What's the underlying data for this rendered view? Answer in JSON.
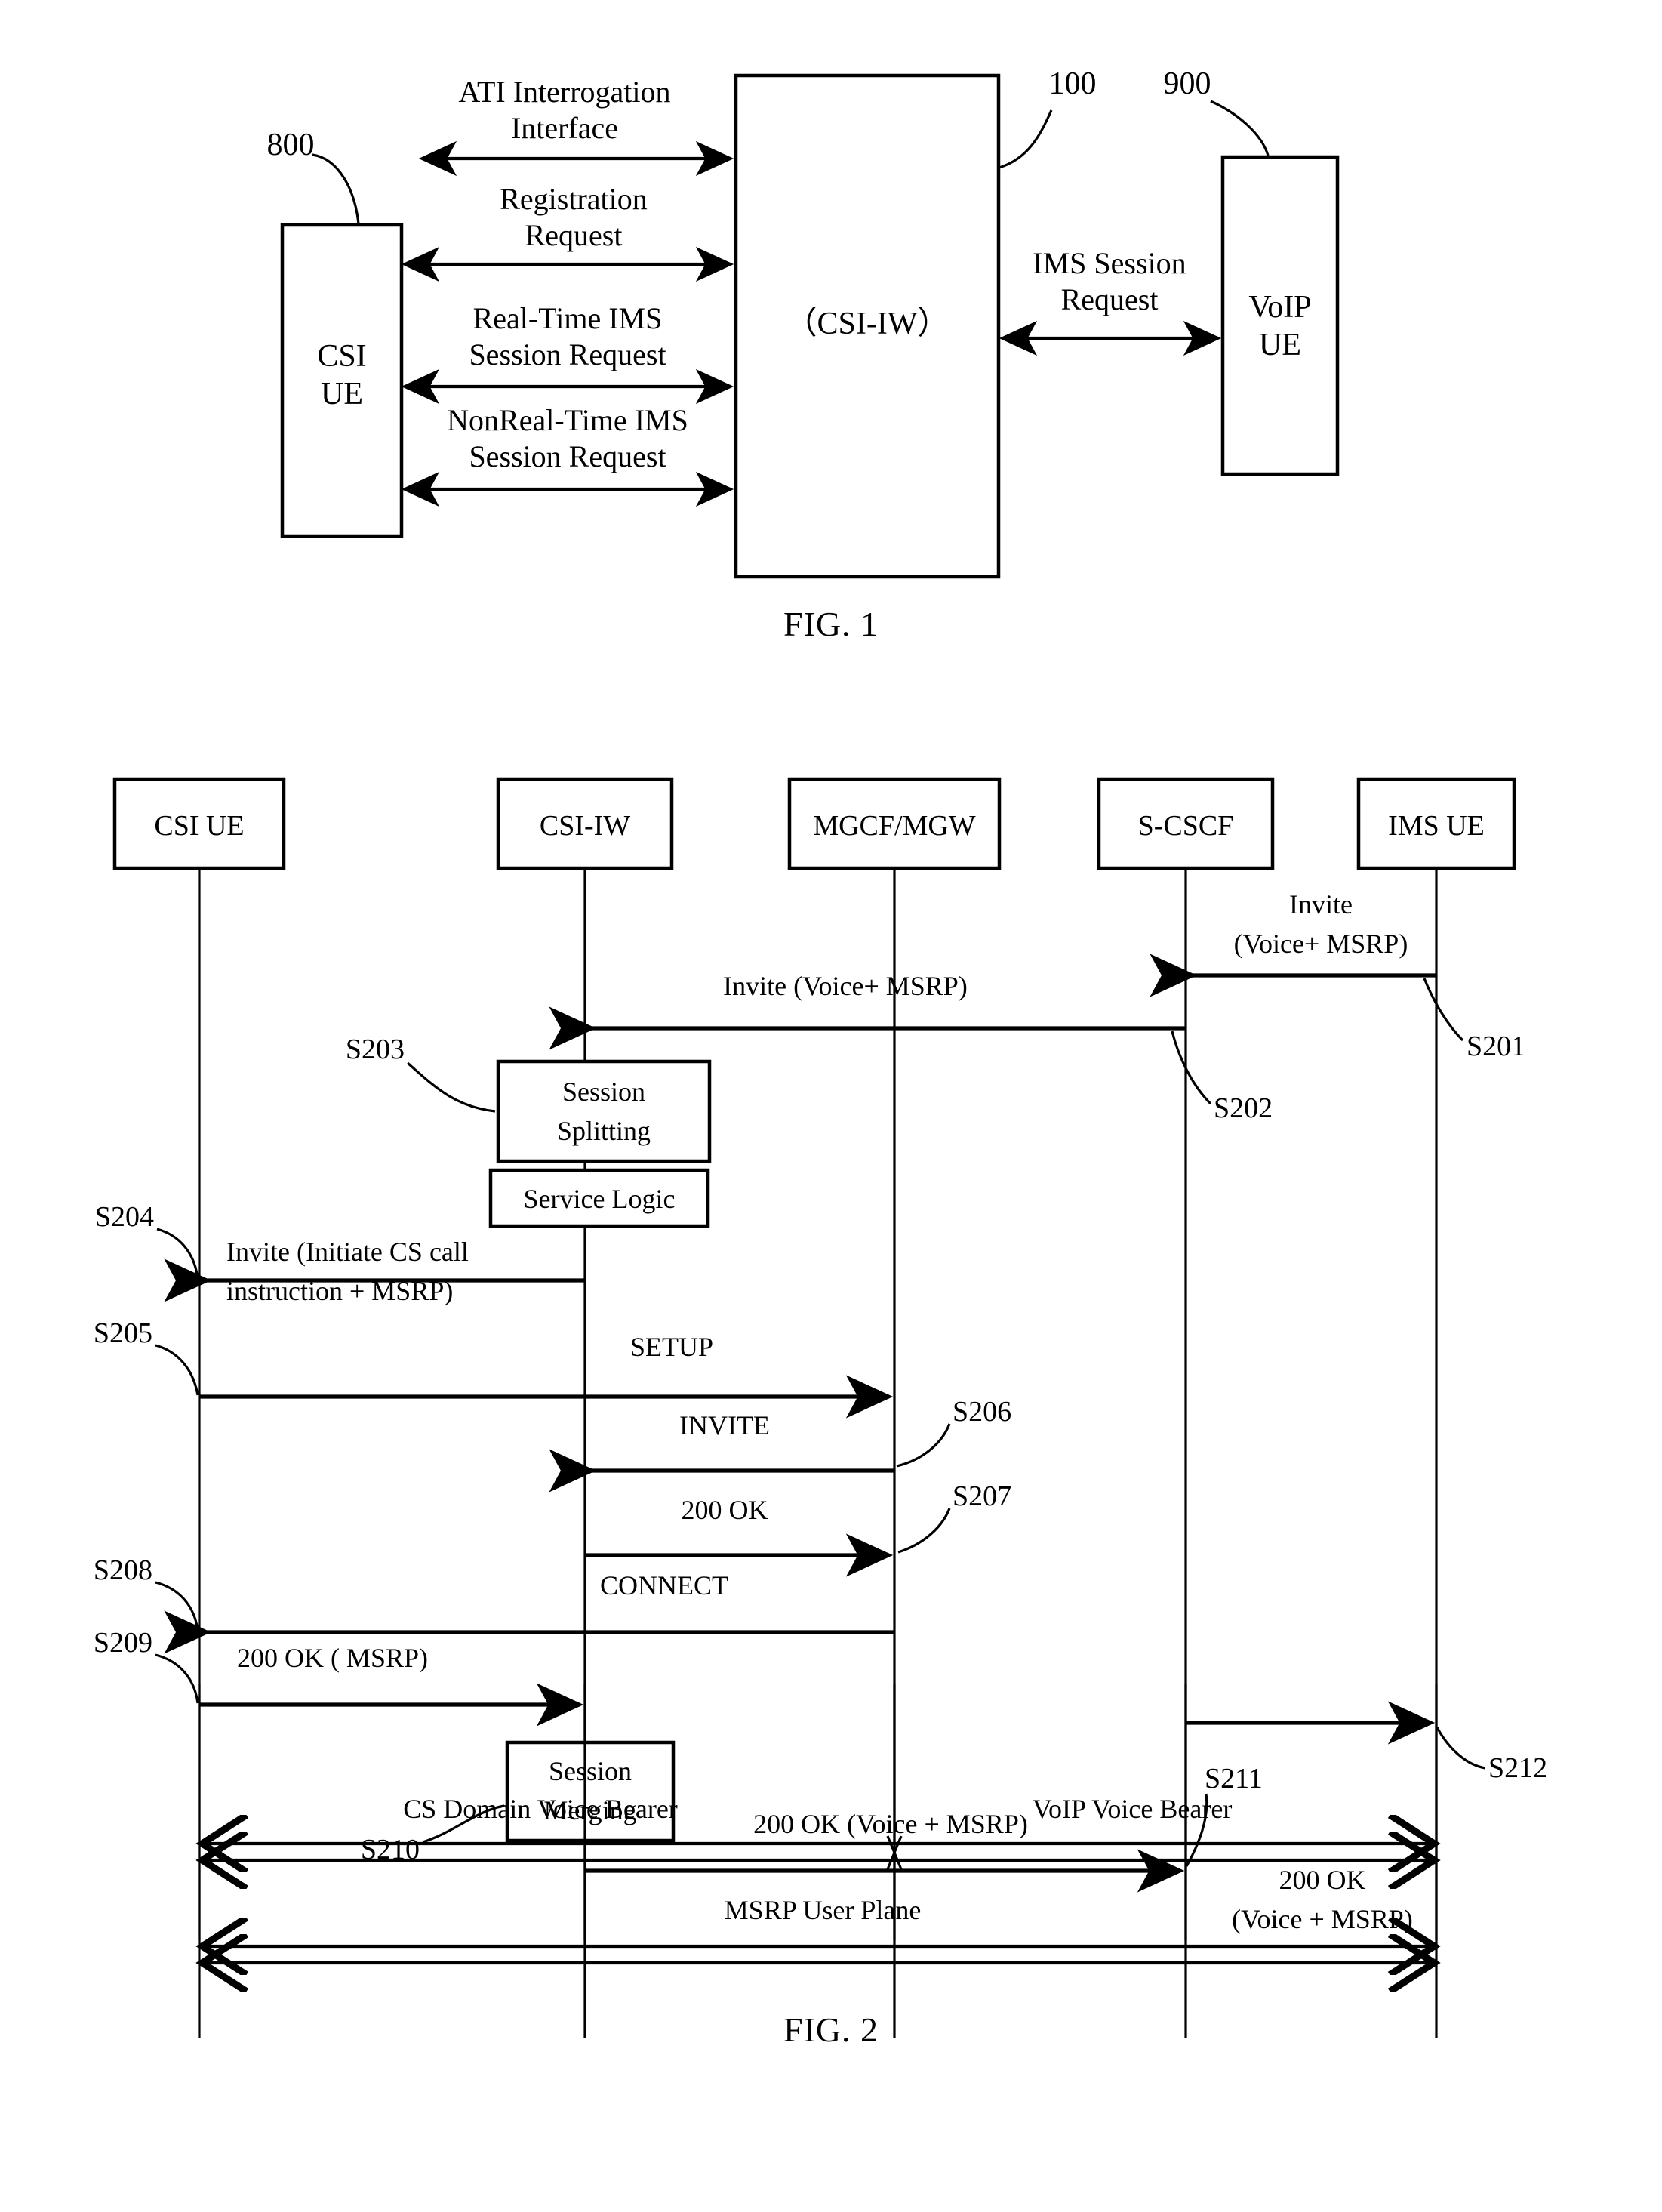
{
  "document": {
    "type": "patent-figure-sheet",
    "figures": [
      {
        "id": "fig1",
        "caption": "FIG. 1"
      },
      {
        "id": "fig2",
        "caption": "FIG. 2"
      }
    ]
  },
  "fig1": {
    "caption": "FIG. 1",
    "nodes": {
      "csi_ue": {
        "line1": "CSI",
        "line2": "UE",
        "ref": "800"
      },
      "csi_iw": {
        "label": "（CSI-IW）",
        "ref": "100"
      },
      "voip_ue": {
        "line1": "VoIP",
        "line2": "UE",
        "ref": "900"
      }
    },
    "interfaces": [
      {
        "line1": "ATI Interrogation",
        "line2": "Interface"
      },
      {
        "line1": "Registration",
        "line2": "Request"
      },
      {
        "line1": "Real-Time IMS",
        "line2": "Session Request"
      },
      {
        "line1": "NonReal-Time IMS",
        "line2": "Session Request"
      },
      {
        "line1": "IMS Session",
        "line2": "Request"
      }
    ]
  },
  "fig2": {
    "caption": "FIG. 2",
    "lifelines": [
      {
        "label": "CSI UE"
      },
      {
        "label": "CSI-IW"
      },
      {
        "label": "MGCF/MGW"
      },
      {
        "label": "S-CSCF"
      },
      {
        "label": "IMS UE"
      }
    ],
    "process_boxes": [
      {
        "line1": "Session",
        "line2": "Splitting",
        "step": "S203"
      },
      {
        "line1": "Service Logic",
        "line2": ""
      },
      {
        "line1": "Session",
        "line2": "Merging",
        "step": "S210"
      }
    ],
    "messages": [
      {
        "step": "S201",
        "line1": "Invite",
        "line2": "(Voice+ MSRP)",
        "from": "IMS UE",
        "to": "S-CSCF"
      },
      {
        "step": "S202",
        "line1": "Invite  (Voice+ MSRP)",
        "line2": "",
        "from": "S-CSCF",
        "to": "CSI-IW"
      },
      {
        "step": "S204",
        "line1": "Invite (Initiate CS call",
        "line2": "instruction + MSRP)",
        "from": "CSI-IW",
        "to": "CSI UE"
      },
      {
        "step": "S205",
        "line1": "SETUP",
        "line2": "",
        "from": "CSI UE",
        "to": "MGCF/MGW"
      },
      {
        "step": "S206",
        "line1": "INVITE",
        "line2": "",
        "from": "MGCF/MGW",
        "to": "CSI-IW"
      },
      {
        "step": "S207",
        "line1": "200 OK",
        "line2": "",
        "from": "CSI-IW",
        "to": "MGCF/MGW"
      },
      {
        "step": "S208",
        "line1": "CONNECT",
        "line2": "",
        "from": "MGCF/MGW",
        "to": "CSI UE"
      },
      {
        "step": "S209",
        "line1": "200 OK ( MSRP)",
        "line2": "",
        "from": "CSI UE",
        "to": "CSI-IW"
      },
      {
        "step": "S211",
        "line1": "200 OK (Voice + MSRP)",
        "line2": "",
        "from": "CSI-IW",
        "to": "S-CSCF"
      },
      {
        "step": "S212",
        "line1": "200 OK",
        "line2": "(Voice + MSRP)",
        "from": "S-CSCF",
        "to": "IMS UE"
      }
    ],
    "bearers": [
      {
        "label": "CS Domain Voice Bearer"
      },
      {
        "label": "VoIP Voice Bearer"
      },
      {
        "label": "MSRP User Plane"
      }
    ]
  }
}
